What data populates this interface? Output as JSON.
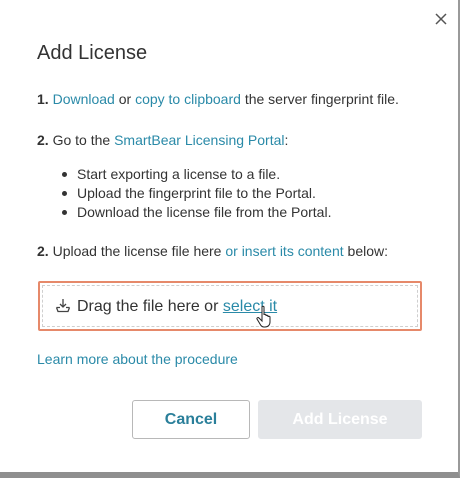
{
  "dialog": {
    "title": "Add License",
    "close_icon": "close-icon"
  },
  "steps": {
    "step1": {
      "number": "1.",
      "download_link": "Download",
      "or": "or",
      "copy_link": "copy to clipboard",
      "rest": "the server fingerprint file."
    },
    "step2": {
      "number": "2.",
      "text": "Go to the",
      "portal_link": "SmartBear Licensing Portal",
      "colon": ":"
    },
    "bullets": [
      "Start exporting a license to a file.",
      "Upload the fingerprint file to the Portal.",
      "Download the license file from the Portal."
    ],
    "step3": {
      "number": "2.",
      "text": "Upload the license file here",
      "insert_link": "or insert its content",
      "rest": "below:"
    }
  },
  "dropzone": {
    "icon": "download-tray-icon",
    "text": "Drag the file here or",
    "select_link": "select it"
  },
  "learn_more": "Learn more about the procedure",
  "buttons": {
    "cancel": "Cancel",
    "add_license": "Add License"
  },
  "colors": {
    "link": "#2a8aa8",
    "dropzone_highlight": "#e6896a",
    "disabled_button_bg": "#e4e6e9"
  }
}
